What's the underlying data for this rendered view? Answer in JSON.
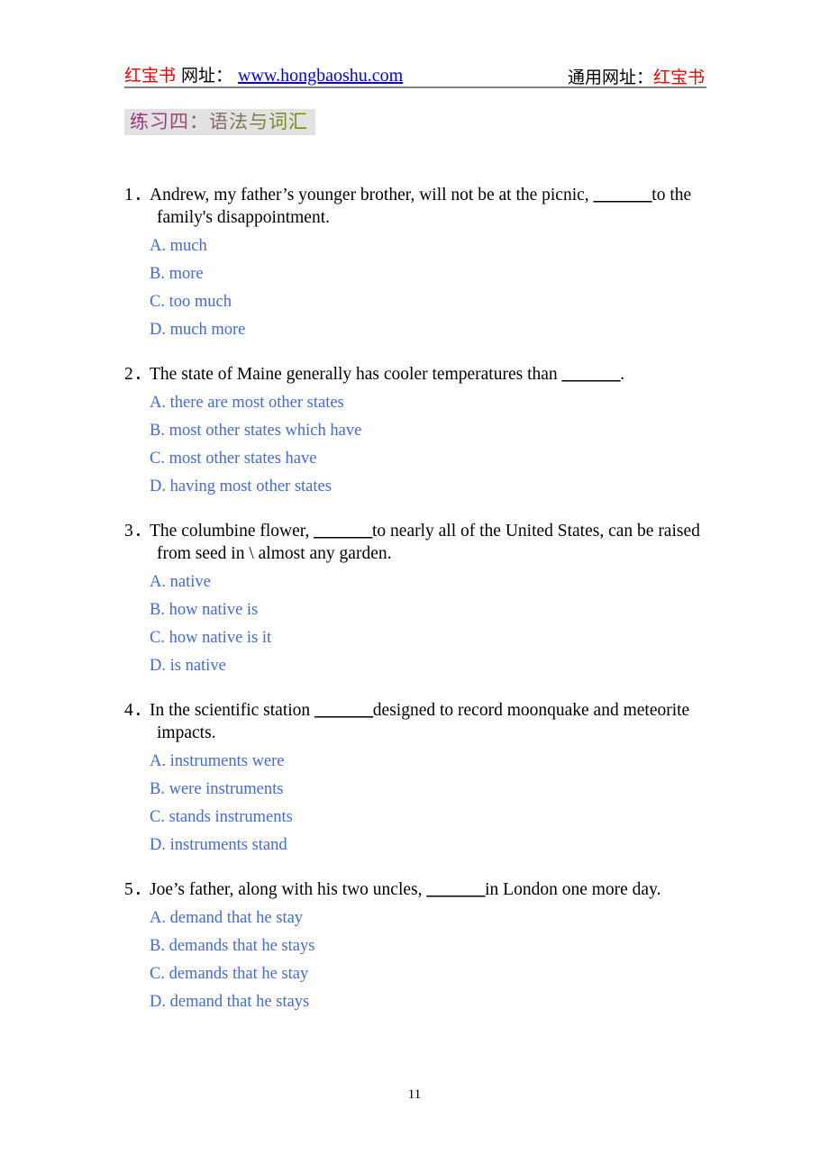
{
  "header": {
    "brand": "红宝书",
    "site_label": "网址：",
    "url": "www.hongbaoshu.com",
    "universal_label": "通用网址：",
    "universal_value": "红宝书",
    "brand_color": "#ee0000",
    "link_color": "#0000ee",
    "rule_color": "#808080"
  },
  "section": {
    "title": "练习四：语法与词汇",
    "background": "#e2e2e2",
    "gradient_from": "#9b2f7a",
    "gradient_to": "#7b8c00"
  },
  "option_color": "#4169e1",
  "questions": [
    {
      "number": "1．",
      "text": "Andrew, my father’s younger brother, will not be at the picnic, ",
      "blank": "_______",
      "text_after": "to the family's disappointment.",
      "options": [
        "A. much",
        "B. more",
        "C. too much",
        "D. much more"
      ]
    },
    {
      "number": "2．",
      "text": "The state of Maine generally has cooler temperatures than ",
      "blank": "_______",
      "text_after": ".",
      "options": [
        "A. there are most other states",
        "B. most other states which have",
        "C. most other states have",
        "D. having most other states"
      ]
    },
    {
      "number": "3．",
      "text": "The columbine flower, ",
      "blank": "_______",
      "text_after": "to nearly all of the United States, can be raised from seed in \\ almost any garden.",
      "options": [
        "A. native",
        "B. how native is",
        "C. how native is it",
        "D. is native"
      ]
    },
    {
      "number": "4．",
      "text": "In the scientific station ",
      "blank": "_______",
      "text_after": "designed to record moonquake and meteorite impacts.",
      "options": [
        "A. instruments were",
        "B. were instruments",
        "C. stands instruments",
        "D. instruments stand"
      ]
    },
    {
      "number": "5．",
      "text": "Joe’s father, along with his two uncles, ",
      "blank": "_______",
      "text_after": "in London one more day.",
      "options": [
        "A. demand that he stay",
        "B. demands that he stays",
        "C. demands that he stay",
        "D. demand that he stays"
      ]
    }
  ],
  "footer": {
    "page_number": "11"
  }
}
